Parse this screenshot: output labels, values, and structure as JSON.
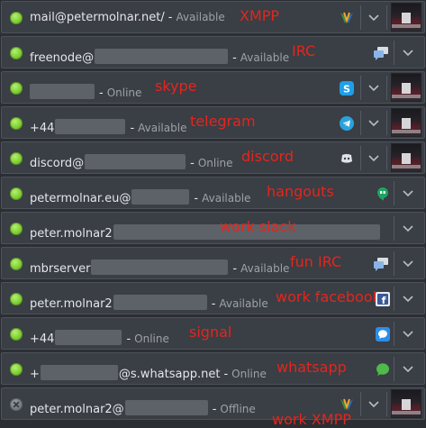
{
  "accounts": [
    {
      "prefix": "mail@petermolnar.net/",
      "suffix": "",
      "status": "Available",
      "annotation": "XMPP",
      "icon": "xmpp-icon",
      "online": true
    },
    {
      "prefix": "freenode@",
      "suffix": "",
      "status": "Available",
      "annotation": "IRC",
      "icon": "irc-chat-icon",
      "online": true
    },
    {
      "prefix": "",
      "suffix": "",
      "status": "Online",
      "annotation": "skype",
      "icon": "skype-icon",
      "online": true
    },
    {
      "prefix": "+44",
      "suffix": "",
      "status": "Available",
      "annotation": "telegram",
      "icon": "telegram-icon",
      "online": true
    },
    {
      "prefix": "discord@",
      "suffix": "",
      "status": "Online",
      "annotation": "discord",
      "icon": "discord-icon",
      "online": true
    },
    {
      "prefix": "petermolnar.eu@",
      "suffix": "",
      "status": "Available",
      "annotation": "hangouts",
      "icon": "hangouts-icon",
      "online": true
    },
    {
      "prefix": "peter.molnar2",
      "suffix": "",
      "status": "",
      "annotation": "work slack",
      "icon": "",
      "online": true
    },
    {
      "prefix": "mbrserver",
      "suffix": "",
      "status": "Available",
      "annotation": "fun IRC",
      "icon": "irc-chat-icon",
      "online": true
    },
    {
      "prefix": "peter.molnar2",
      "suffix": "",
      "status": "Available",
      "annotation": "work facebook",
      "icon": "facebook-icon",
      "online": true
    },
    {
      "prefix": "+44",
      "suffix": "",
      "status": "Online",
      "annotation": "signal",
      "icon": "signal-icon",
      "online": true
    },
    {
      "prefix": "+",
      "suffix": "@s.whatsapp.net",
      "status": "Online",
      "annotation": "whatsapp",
      "icon": "whatsapp-icon",
      "online": true
    },
    {
      "prefix": "peter.molnar2@",
      "suffix": "",
      "status": "Offline",
      "annotation": "work XMPP",
      "icon": "xmpp-icon",
      "online": false
    }
  ],
  "separators": [
    "-",
    "-",
    "-",
    "-",
    "-",
    "-",
    "",
    "-",
    "-",
    "-",
    "-",
    "-"
  ],
  "colors": {
    "annotation": "#e3261d",
    "row_bg": "#3a3e45",
    "online": "#7ccf2f",
    "offline": "#6f737a"
  }
}
